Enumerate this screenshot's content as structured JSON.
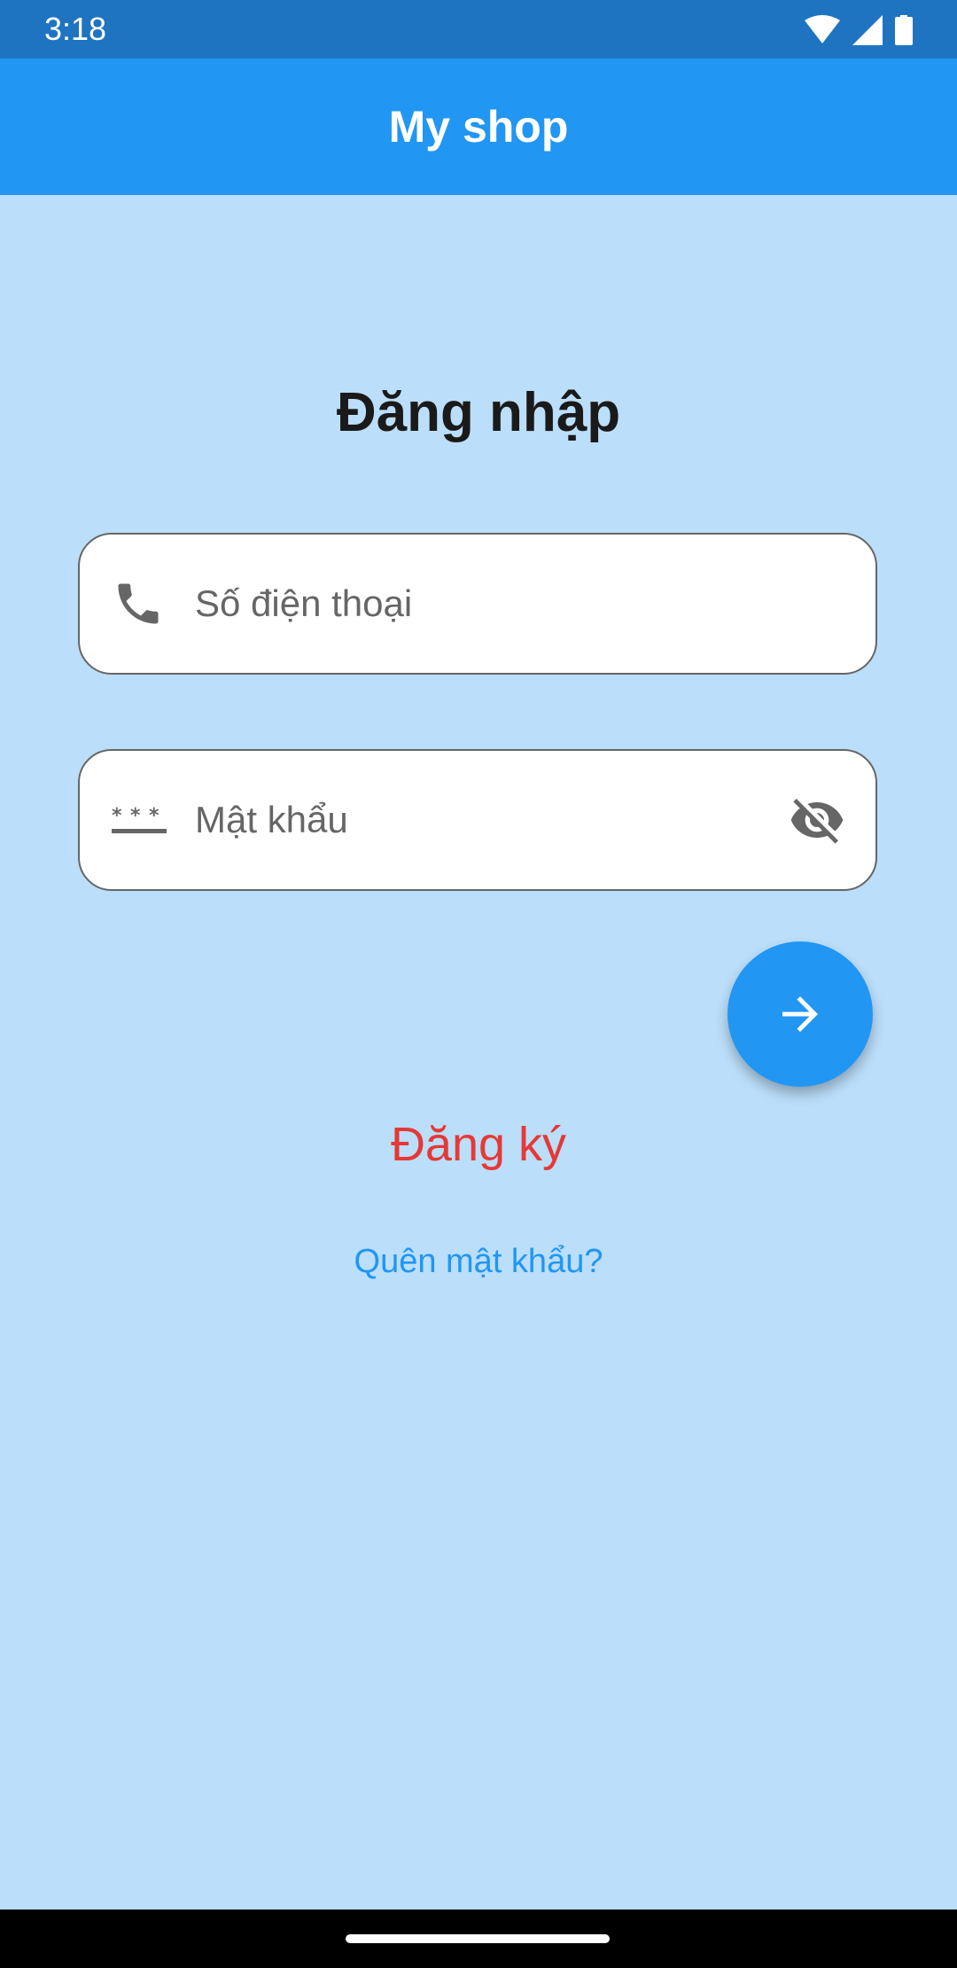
{
  "status_bar": {
    "time": "3:18",
    "icons": [
      "wifi-icon",
      "signal-icon",
      "battery-icon"
    ]
  },
  "app_bar": {
    "title": "My shop"
  },
  "login": {
    "title": "Đăng nhập",
    "phone_field": {
      "placeholder": "Số điện thoại",
      "value": "",
      "icon": "phone-icon"
    },
    "password_field": {
      "placeholder": "Mật khẩu",
      "value": "",
      "icon": "password-icon",
      "toggle_icon": "visibility-off-icon"
    },
    "submit_icon": "arrow-forward-icon",
    "register_label": "Đăng ký",
    "forgot_label": "Quên mật khẩu?"
  },
  "colors": {
    "status_bar": "#1E74C1",
    "app_bar": "#2196F3",
    "background": "#BBDEFA",
    "register": "#E53935",
    "link": "#2196F3"
  }
}
